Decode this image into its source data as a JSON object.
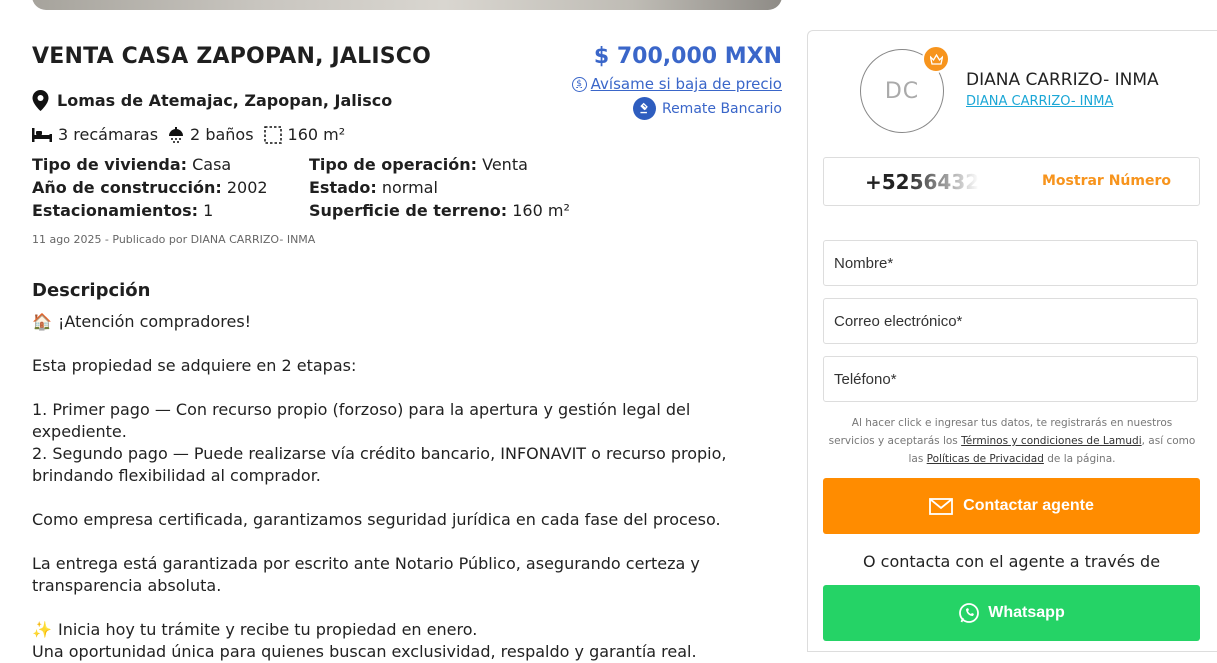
{
  "listing": {
    "title": "VENTA CASA ZAPOPAN, JALISCO",
    "price": "$ 700,000 MXN",
    "price_alert": "Avísame si baja de precio",
    "badge": "Remate Bancario",
    "location": "Lomas de Atemajac, Zapopan, Jalisco",
    "features": {
      "bedrooms": "3 recámaras",
      "bathrooms": "2 baños",
      "area": "160 m²"
    },
    "specs": {
      "tipo_vivienda_k": "Tipo de vivienda:",
      "tipo_vivienda_v": "Casa",
      "tipo_operacion_k": "Tipo de operación:",
      "tipo_operacion_v": "Venta",
      "anio_k": "Año de construcción:",
      "anio_v": "2002",
      "estado_k": "Estado:",
      "estado_v": "normal",
      "estacionamientos_k": "Estacionamientos:",
      "estacionamientos_v": "1",
      "superficie_k": "Superficie de terreno:",
      "superficie_v": "160 m²"
    },
    "published": "11 ago 2025 - Publicado por DIANA CARRIZO- INMA",
    "description_title": "Descripción",
    "description": {
      "l1": "¡Atención compradores!",
      "l2": "Esta propiedad se adquiere en 2 etapas:",
      "l3": "1. Primer pago — Con recurso propio (forzoso) para la apertura y gestión legal del expediente.",
      "l4": "2. Segundo pago — Puede realizarse vía crédito bancario, INFONAVIT o recurso propio, brindando flexibilidad al comprador.",
      "l5": "Como empresa certificada, garantizamos seguridad jurídica en cada fase del proceso.",
      "l6": "La entrega está garantizada por escrito ante Notario Público, asegurando certeza y transparencia absoluta.",
      "l7": "Inicia hoy tu trámite y recibe tu propiedad en enero.",
      "l8": "Una oportunidad única para quienes buscan exclusividad, respaldo y garantía real."
    }
  },
  "agent": {
    "initials": "DC",
    "name": "DIANA CARRIZO- INMA",
    "link": "DIANA CARRIZO- INMA",
    "phone_partial": "+5256432",
    "show_number": "Mostrar Número"
  },
  "form": {
    "name_placeholder": "Nombre*",
    "email_placeholder": "Correo electrónico*",
    "phone_placeholder": "Teléfono*",
    "legal_pre": "Al hacer click e ingresar tus datos, te registrarás en nuestros servicios y aceptarás los ",
    "legal_terms": "Términos y condiciones de Lamudi",
    "legal_mid": ", así como las ",
    "legal_privacy": "Políticas de Privacidad",
    "legal_post": " de la página.",
    "contact_button": "Contactar agente",
    "or_text": "O contacta con el agente a través de",
    "whatsapp_button": "Whatsapp"
  },
  "colors": {
    "price_blue": "#3a66c9",
    "orange": "#ff8c00",
    "whatsapp_green": "#25d366"
  }
}
